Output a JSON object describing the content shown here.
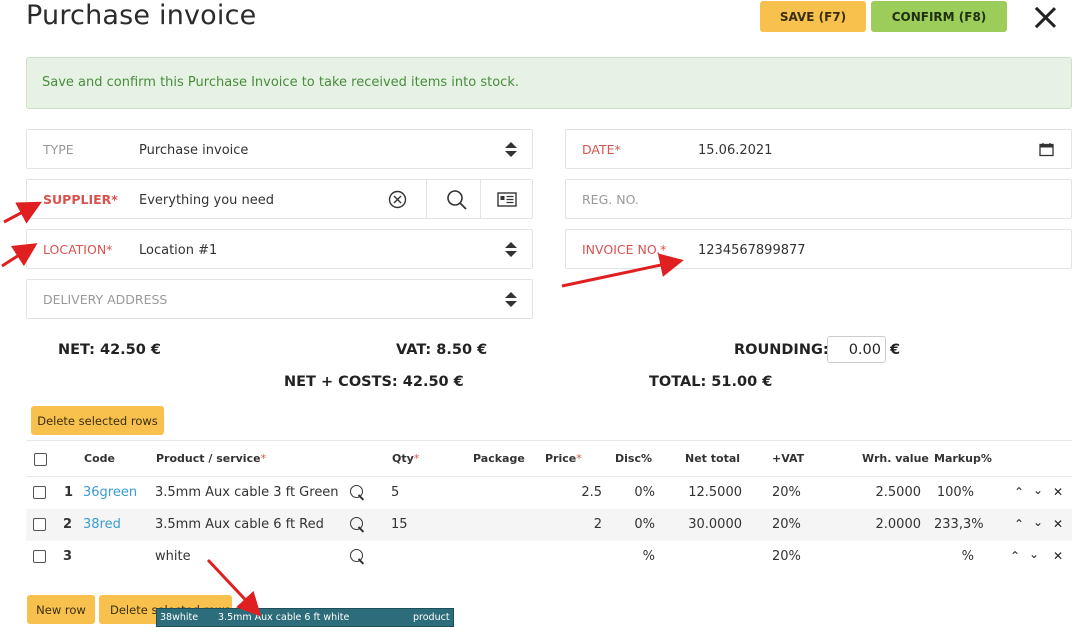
{
  "header": {
    "title": "Purchase invoice",
    "save_label": "SAVE (F7)",
    "confirm_label": "CONFIRM (F8)"
  },
  "alert": "Save and confirm this Purchase Invoice to take received items into stock.",
  "form": {
    "type_label": "TYPE",
    "type_value": "Purchase invoice",
    "supplier_label": "SUPPLIER*",
    "supplier_value": "Everything you need",
    "location_label": "LOCATION*",
    "location_value": "Location #1",
    "delivery_label": "DELIVERY ADDRESS",
    "date_label": "DATE*",
    "date_value": "15.06.2021",
    "regno_label": "REG. NO.",
    "invoice_label": "INVOICE NO.*",
    "invoice_value": "1234567899877"
  },
  "totals": {
    "net": "NET: 42.50 €",
    "vat": "VAT: 8.50 €",
    "rounding_label": "ROUNDING:",
    "rounding_value": "0.00",
    "rounding_currency": "€",
    "net_costs": "NET + COSTS: 42.50 €",
    "total": "TOTAL: 51.00 €"
  },
  "delete_top_label": "Delete selected rows",
  "table": {
    "headers": {
      "code": "Code",
      "product": "Product / service",
      "qty": "Qty",
      "package": "Package",
      "price": "Price",
      "disc": "Disc%",
      "net_total": "Net total",
      "vat": "+VAT",
      "wrh": "Wrh. value",
      "markup": "Markup%"
    },
    "rows": [
      {
        "num": "1",
        "code": "36green",
        "product": "3.5mm Aux cable 3 ft Green",
        "qty": "5",
        "price": "2.5",
        "disc": "0%",
        "net_total": "12.5000",
        "vat": "20%",
        "wrh": "2.5000",
        "markup": "100%"
      },
      {
        "num": "2",
        "code": "38red",
        "product": "3.5mm Aux cable 6 ft Red",
        "qty": "15",
        "price": "2",
        "disc": "0%",
        "net_total": "30.0000",
        "vat": "20%",
        "wrh": "2.0000",
        "markup": "233,3%"
      },
      {
        "num": "3",
        "code": "",
        "product": "white",
        "qty": "",
        "price": "",
        "disc": "%",
        "net_total": "",
        "vat": "20%",
        "wrh": "",
        "markup": "%"
      }
    ]
  },
  "footer": {
    "new_row_label": "New row",
    "delete_label": "Delete selected rows"
  },
  "autocomplete": {
    "code": "38white",
    "name": "3.5mm Aux cable 6 ft white",
    "kind": "product"
  },
  "colors": {
    "save": "#f8c14e",
    "confirm": "#9ccc5a",
    "required": "#d9534f",
    "link": "#3a9ccf",
    "annotation_arrow": "#e02020"
  }
}
